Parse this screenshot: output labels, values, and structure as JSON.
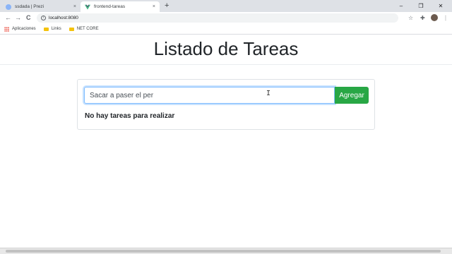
{
  "browser": {
    "tabs": [
      {
        "title": "ssdada | Prezi",
        "active": false
      },
      {
        "title": "frontend-tareas",
        "active": true
      }
    ],
    "new_tab": "+",
    "close_glyph": "×",
    "window_controls": {
      "minimize": "–",
      "restore": "❐",
      "close": "✕"
    },
    "nav": {
      "back": "←",
      "forward": "→",
      "reload": "C"
    },
    "address": {
      "url": "localhost:8080"
    },
    "toolbar_icons": {
      "star": "☆",
      "extensions": "✚",
      "menu": "⋮"
    },
    "bookmarks": [
      {
        "label": "Aplicaciones",
        "icon": "apps-icon"
      },
      {
        "label": "Links",
        "icon": "folder-icon"
      },
      {
        "label": "NET CORE",
        "icon": "folder-icon"
      }
    ]
  },
  "app": {
    "title": "Listado de Tareas",
    "input": {
      "value": "Sacar a paser el per",
      "placeholder": ""
    },
    "add_button": "Agregar",
    "empty_message": "No hay tareas para realizar"
  },
  "colors": {
    "button_success": "#28a745",
    "input_focus_border": "#80bdff",
    "vue_logo": "#42b883"
  }
}
